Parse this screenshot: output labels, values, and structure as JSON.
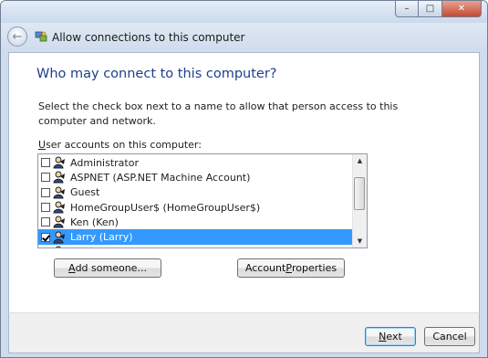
{
  "window": {
    "title": "Allow connections to this computer",
    "caption_minimize": "–",
    "caption_maximize": "□",
    "caption_close": "✕"
  },
  "nav": {
    "back_glyph": "←"
  },
  "page": {
    "heading": "Who may connect to this computer?",
    "description": "Select the check box next to a name to allow that person access to this computer and network.",
    "list_label_hotkey": "U",
    "list_label_rest": "ser accounts on this computer:"
  },
  "accounts": [
    {
      "name": "Administrator",
      "checked": false,
      "selected": false
    },
    {
      "name": "ASPNET (ASP.NET Machine Account)",
      "checked": false,
      "selected": false
    },
    {
      "name": "Guest",
      "checked": false,
      "selected": false
    },
    {
      "name": "HomeGroupUser$ (HomeGroupUser$)",
      "checked": false,
      "selected": false
    },
    {
      "name": "Ken (Ken)",
      "checked": false,
      "selected": false
    },
    {
      "name": "Larry (Larry)",
      "checked": true,
      "selected": true
    },
    {
      "name": "Owen (Nick)",
      "checked": false,
      "selected": false
    }
  ],
  "buttons": {
    "add_someone_hotkey": "A",
    "add_someone_rest": "dd someone...",
    "account_properties_pre": "Account ",
    "account_properties_hotkey": "P",
    "account_properties_rest": "roperties",
    "next_hotkey": "N",
    "next_rest": "ext",
    "cancel": "Cancel"
  },
  "colors": {
    "heading": "#1d3f8f",
    "selection": "#3399ff",
    "chrome": "#cfdced"
  }
}
